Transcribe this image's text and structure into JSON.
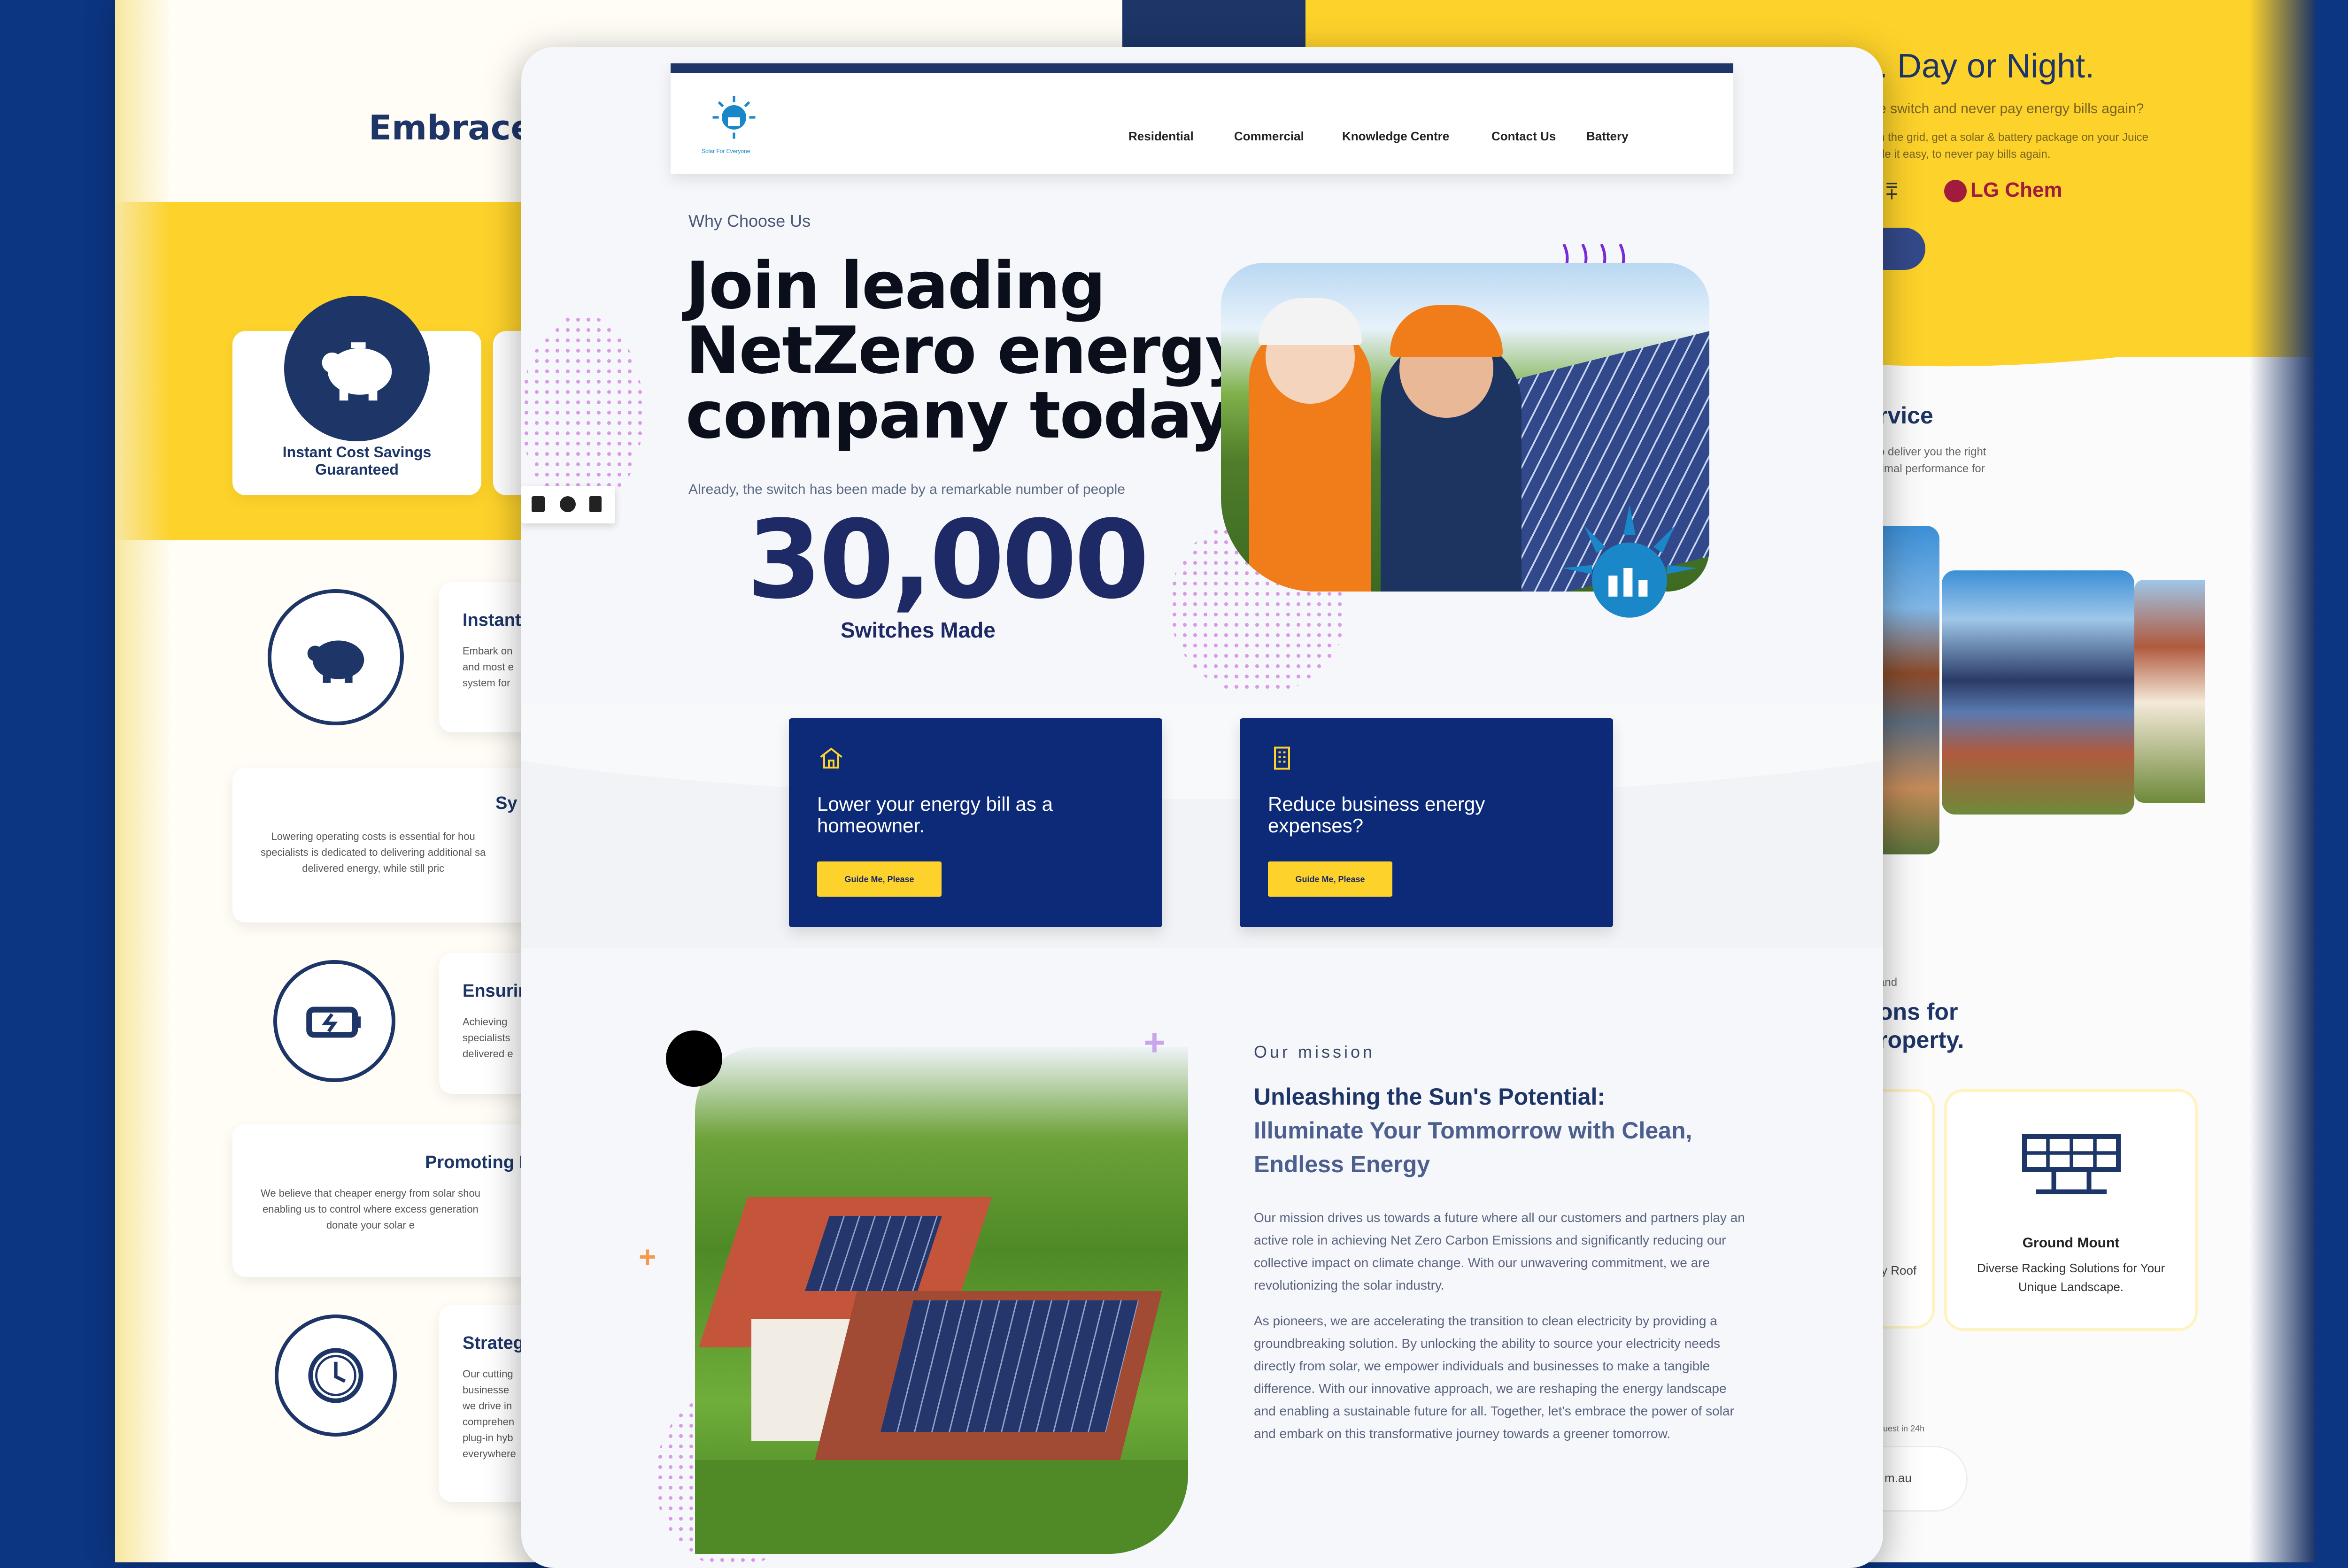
{
  "left_panel": {
    "heading": "Embrace",
    "savings_card_title": "Instant Cost Savings Guaranteed",
    "cards": [
      {
        "title": "Instant",
        "text": "Embark on\nand most e\nsystem for"
      },
      {
        "title": "Sy",
        "text": "Lowering operating costs is essential for hou\nspecialists is dedicated to delivering additional sa\ndelivered energy, while still pric"
      },
      {
        "title": "Ensurin",
        "text": "Achieving\nspecialists\ndelivered e"
      },
      {
        "title": "Promoting E",
        "text": "We believe that cheaper energy from solar shou\nenabling us to control where excess generation\ndonate your solar e"
      },
      {
        "title": "Strateg",
        "text": "Our cutting\nbusinesse\nwe drive in\ncomprehen\nplug-in hyb\neverywhere"
      }
    ]
  },
  "right_panel": {
    "title": ". Day or Night.",
    "subtitle": "e switch and never pay energy bills again?",
    "body": "n the grid, get a solar & battery package on your Juice\nde it easy, to never pay bills again.",
    "brand": "LG Chem",
    "service_heading": "rvice",
    "service_text": "o deliver you the right\ntimal performance for",
    "and_label": "and",
    "solutions_heading": "ons for\nroperty.",
    "roof_label": "y Roof",
    "ground_mount": {
      "title": "Ground Mount",
      "text": "Diverse Racking Solutions for Your\nUnique Landscape."
    },
    "reply_note": "quest in 24h",
    "email_fragment": "m.au"
  },
  "nav": {
    "logo_text": "Solar For Everyone",
    "items": [
      "Residential",
      "Commercial",
      "Knowledge Centre",
      "Contact Us",
      "Battery"
    ]
  },
  "hero": {
    "eyebrow": "Why Choose Us",
    "title": "Join leading NetZero energy company today.",
    "subtitle": "Already, the switch has been made by a remarkable number of people",
    "count": "30,000",
    "count_label": "Switches Made"
  },
  "offers": [
    {
      "icon": "house-icon",
      "text": "Lower your energy bill as a homeowner.",
      "button": "Guide Me, Please"
    },
    {
      "icon": "building-icon",
      "text": "Reduce business energy expenses?",
      "button": "Guide Me, Please"
    }
  ],
  "mission": {
    "eyebrow": "Our mission",
    "heading_line1": "Unleashing the Sun's Potential:",
    "heading_line2": "Illuminate Your Tommorrow with Clean,",
    "heading_line3": "Endless Energy",
    "para1": "Our mission drives us towards a future where all our customers and partners play an active role in achieving Net Zero Carbon Emissions and significantly reducing our collective impact on climate change. With our unwavering commitment, we are revolutionizing the solar industry.",
    "para2": "As pioneers, we are accelerating the transition to clean electricity by providing a groundbreaking solution. By unlocking the ability to source your electricity needs directly from solar, we empower individuals and businesses to make a tangible difference. With our innovative approach, we are reshaping the energy landscape and enabling a sustainable future for all. Together, let's embrace the power of solar and embark on this transformative journey towards a greener tomorrow."
  },
  "colors": {
    "navy": "#1d3567",
    "card_blue": "#0c2a78",
    "yellow": "#fdd22a",
    "background": "#0c3582"
  }
}
